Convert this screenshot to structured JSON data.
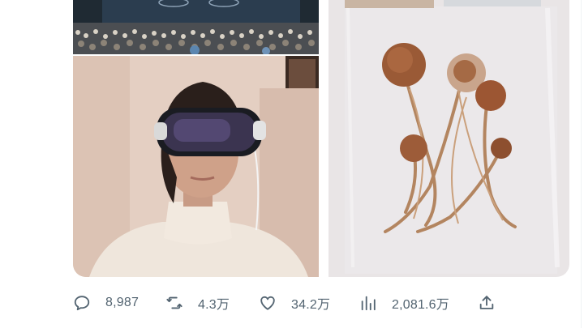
{
  "tweet": {
    "media": [
      {
        "name": "event-crowd-photo"
      },
      {
        "name": "woman-wearing-headset-photo"
      },
      {
        "name": "dried-mushrooms-bag-photo"
      }
    ],
    "actions": {
      "reply": {
        "icon": "reply-icon",
        "count": "8,987"
      },
      "retweet": {
        "icon": "retweet-icon",
        "count": "4.3万"
      },
      "like": {
        "icon": "heart-icon",
        "count": "34.2万"
      },
      "views": {
        "icon": "views-chart-icon",
        "count": "2,081.6万"
      },
      "share": {
        "icon": "share-icon"
      }
    },
    "colors": {
      "action_gray": "#536471",
      "border": "#eff3f4"
    }
  }
}
